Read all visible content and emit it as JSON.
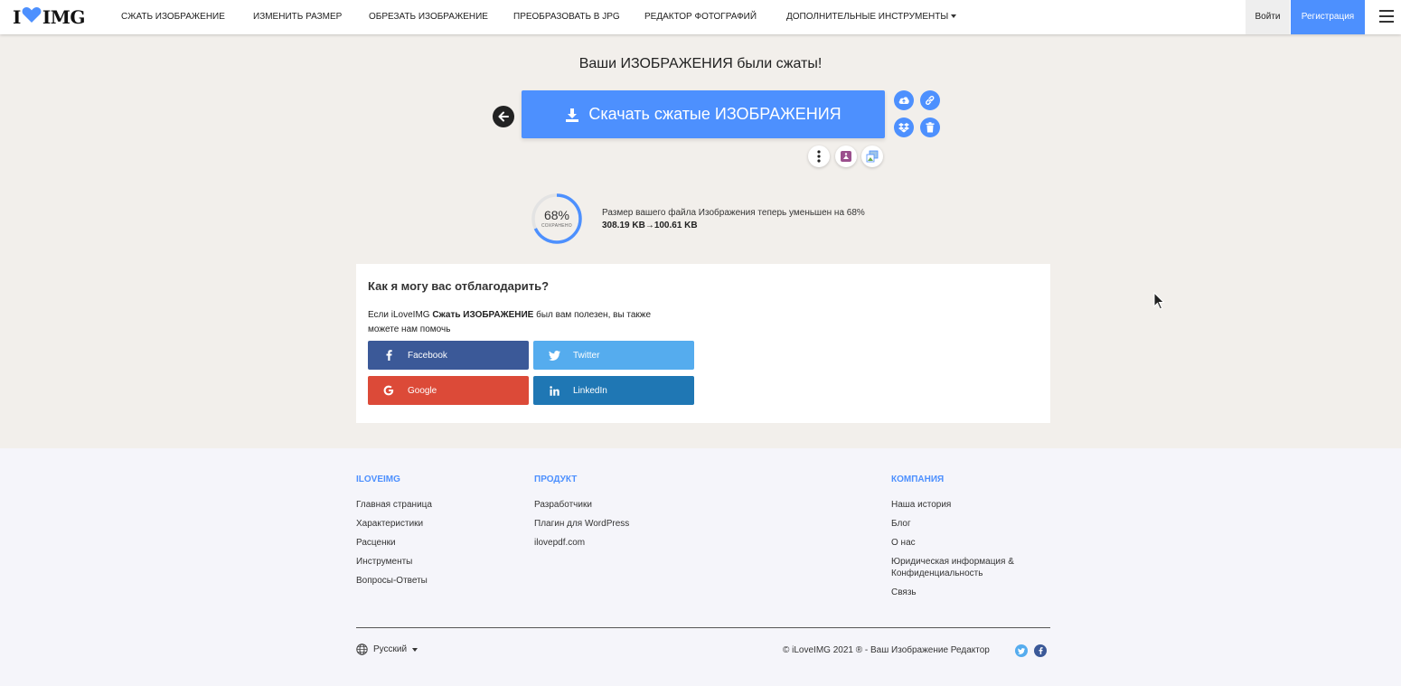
{
  "header": {
    "logo_left": "I",
    "logo_right": "IMG",
    "nav": [
      "СЖАТЬ ИЗОБРАЖЕНИЕ",
      "ИЗМЕНИТЬ РАЗМЕР",
      "ОБРЕЗАТЬ ИЗОБРАЖЕНИЕ",
      "ПРЕОБРАЗОВАТЬ В JPG",
      "РЕДАКТОР ФОТОГРАФИЙ",
      "ДОПОЛНИТЕЛЬНЫЕ ИНСТРУМЕНТЫ"
    ],
    "login": "Войти",
    "register": "Регистрация"
  },
  "main": {
    "title": "Ваши ИЗОБРАЖЕНИЯ были сжаты!",
    "download_label": "Скачать сжатые ИЗОБРАЖЕНИЯ",
    "saved_percent": "68%",
    "saved_label": "СОХРАНЕНО",
    "saved_fraction": 0.68,
    "result_text": "Размер вашего файла Изображения теперь уменьшен на 68%",
    "size_before": "308.19 KB",
    "size_arrow": "→",
    "size_after": "100.61 KB"
  },
  "thanks": {
    "heading": "Как я могу вас отблагодарить?",
    "text_prefix": "Если iLoveIMG ",
    "text_bold": "Сжать ИЗОБРАЖЕНИЕ",
    "text_suffix": " был вам полезен, вы также можете нам помочь",
    "buttons": [
      "Facebook",
      "Twitter",
      "Google",
      "LinkedIn"
    ]
  },
  "colors": {
    "accent": "#4d90fe",
    "facebook": "#3b5998",
    "twitter": "#55acee",
    "google": "#dc4a38",
    "linkedin": "#1f77b4"
  },
  "footer": {
    "col1": {
      "title": "ILOVEIMG",
      "links": [
        "Главная страница",
        "Характеристики",
        "Расценки",
        "Инструменты",
        "Вопросы-Ответы"
      ]
    },
    "col2": {
      "title": "ПРОДУКТ",
      "links": [
        "Разработчики",
        "Плагин для WordPress",
        "ilovepdf.com"
      ]
    },
    "col3": {
      "title": "КОМПАНИЯ",
      "links": [
        "Наша история",
        "Блог",
        "О нас",
        "Юридическая информация & Конфиденциальность",
        "Связь"
      ]
    },
    "language": "Русский",
    "copyright": "© iLoveIMG 2021 ® - Ваш Изображение Редактор"
  }
}
